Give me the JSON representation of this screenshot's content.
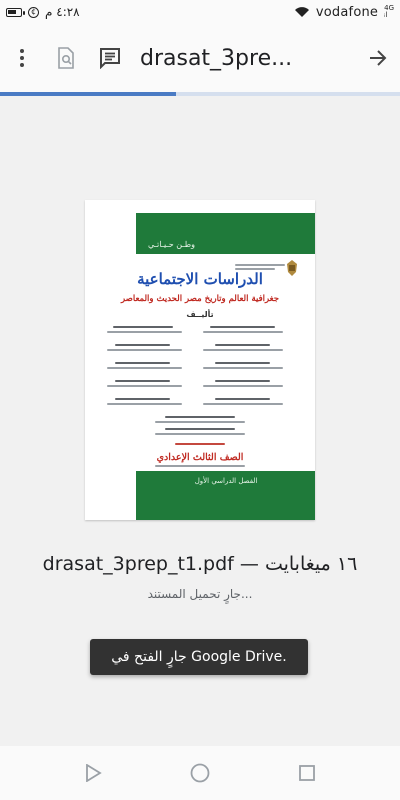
{
  "status_bar": {
    "carrier": "vodafone",
    "network_badge_top": "4G",
    "network_badge_bottom": "ᵢl",
    "time": "٤:٢٨ م",
    "battery_level": 0.7
  },
  "toolbar": {
    "title": "drasat_3pre..."
  },
  "load_progress": 0.44,
  "document_preview": {
    "top_band_text": "وطـن حـيـاتـي",
    "title": "الدراسات الاجتماعية",
    "subtitle": "جغرافية العالم وتاريخ مصر الحديث والمعاصر",
    "authors_label": "تأليــف",
    "grade": "الصف الثالث الإعدادي",
    "term": "الفصل الدراسي الأول"
  },
  "file": {
    "name_line": "drasat_3prep_t1.pdf — ١٦ ميغابايت",
    "status": "جارٍ تحميل المستند..."
  },
  "toast": {
    "message": "جارٍ الفتح في Google Drive."
  },
  "icons": {
    "more": "more-vert-icon",
    "find": "find-in-page-icon",
    "comment": "comment-icon",
    "open": "arrow-forward-icon",
    "back": "nav-back-icon",
    "home": "nav-home-icon",
    "recents": "nav-recents-icon"
  },
  "colors": {
    "progress": "#4a7bc4",
    "toast_bg": "#323232",
    "doc_green": "#1f7a3a",
    "doc_title_blue": "#1f4fb0",
    "doc_red": "#c02b23"
  }
}
